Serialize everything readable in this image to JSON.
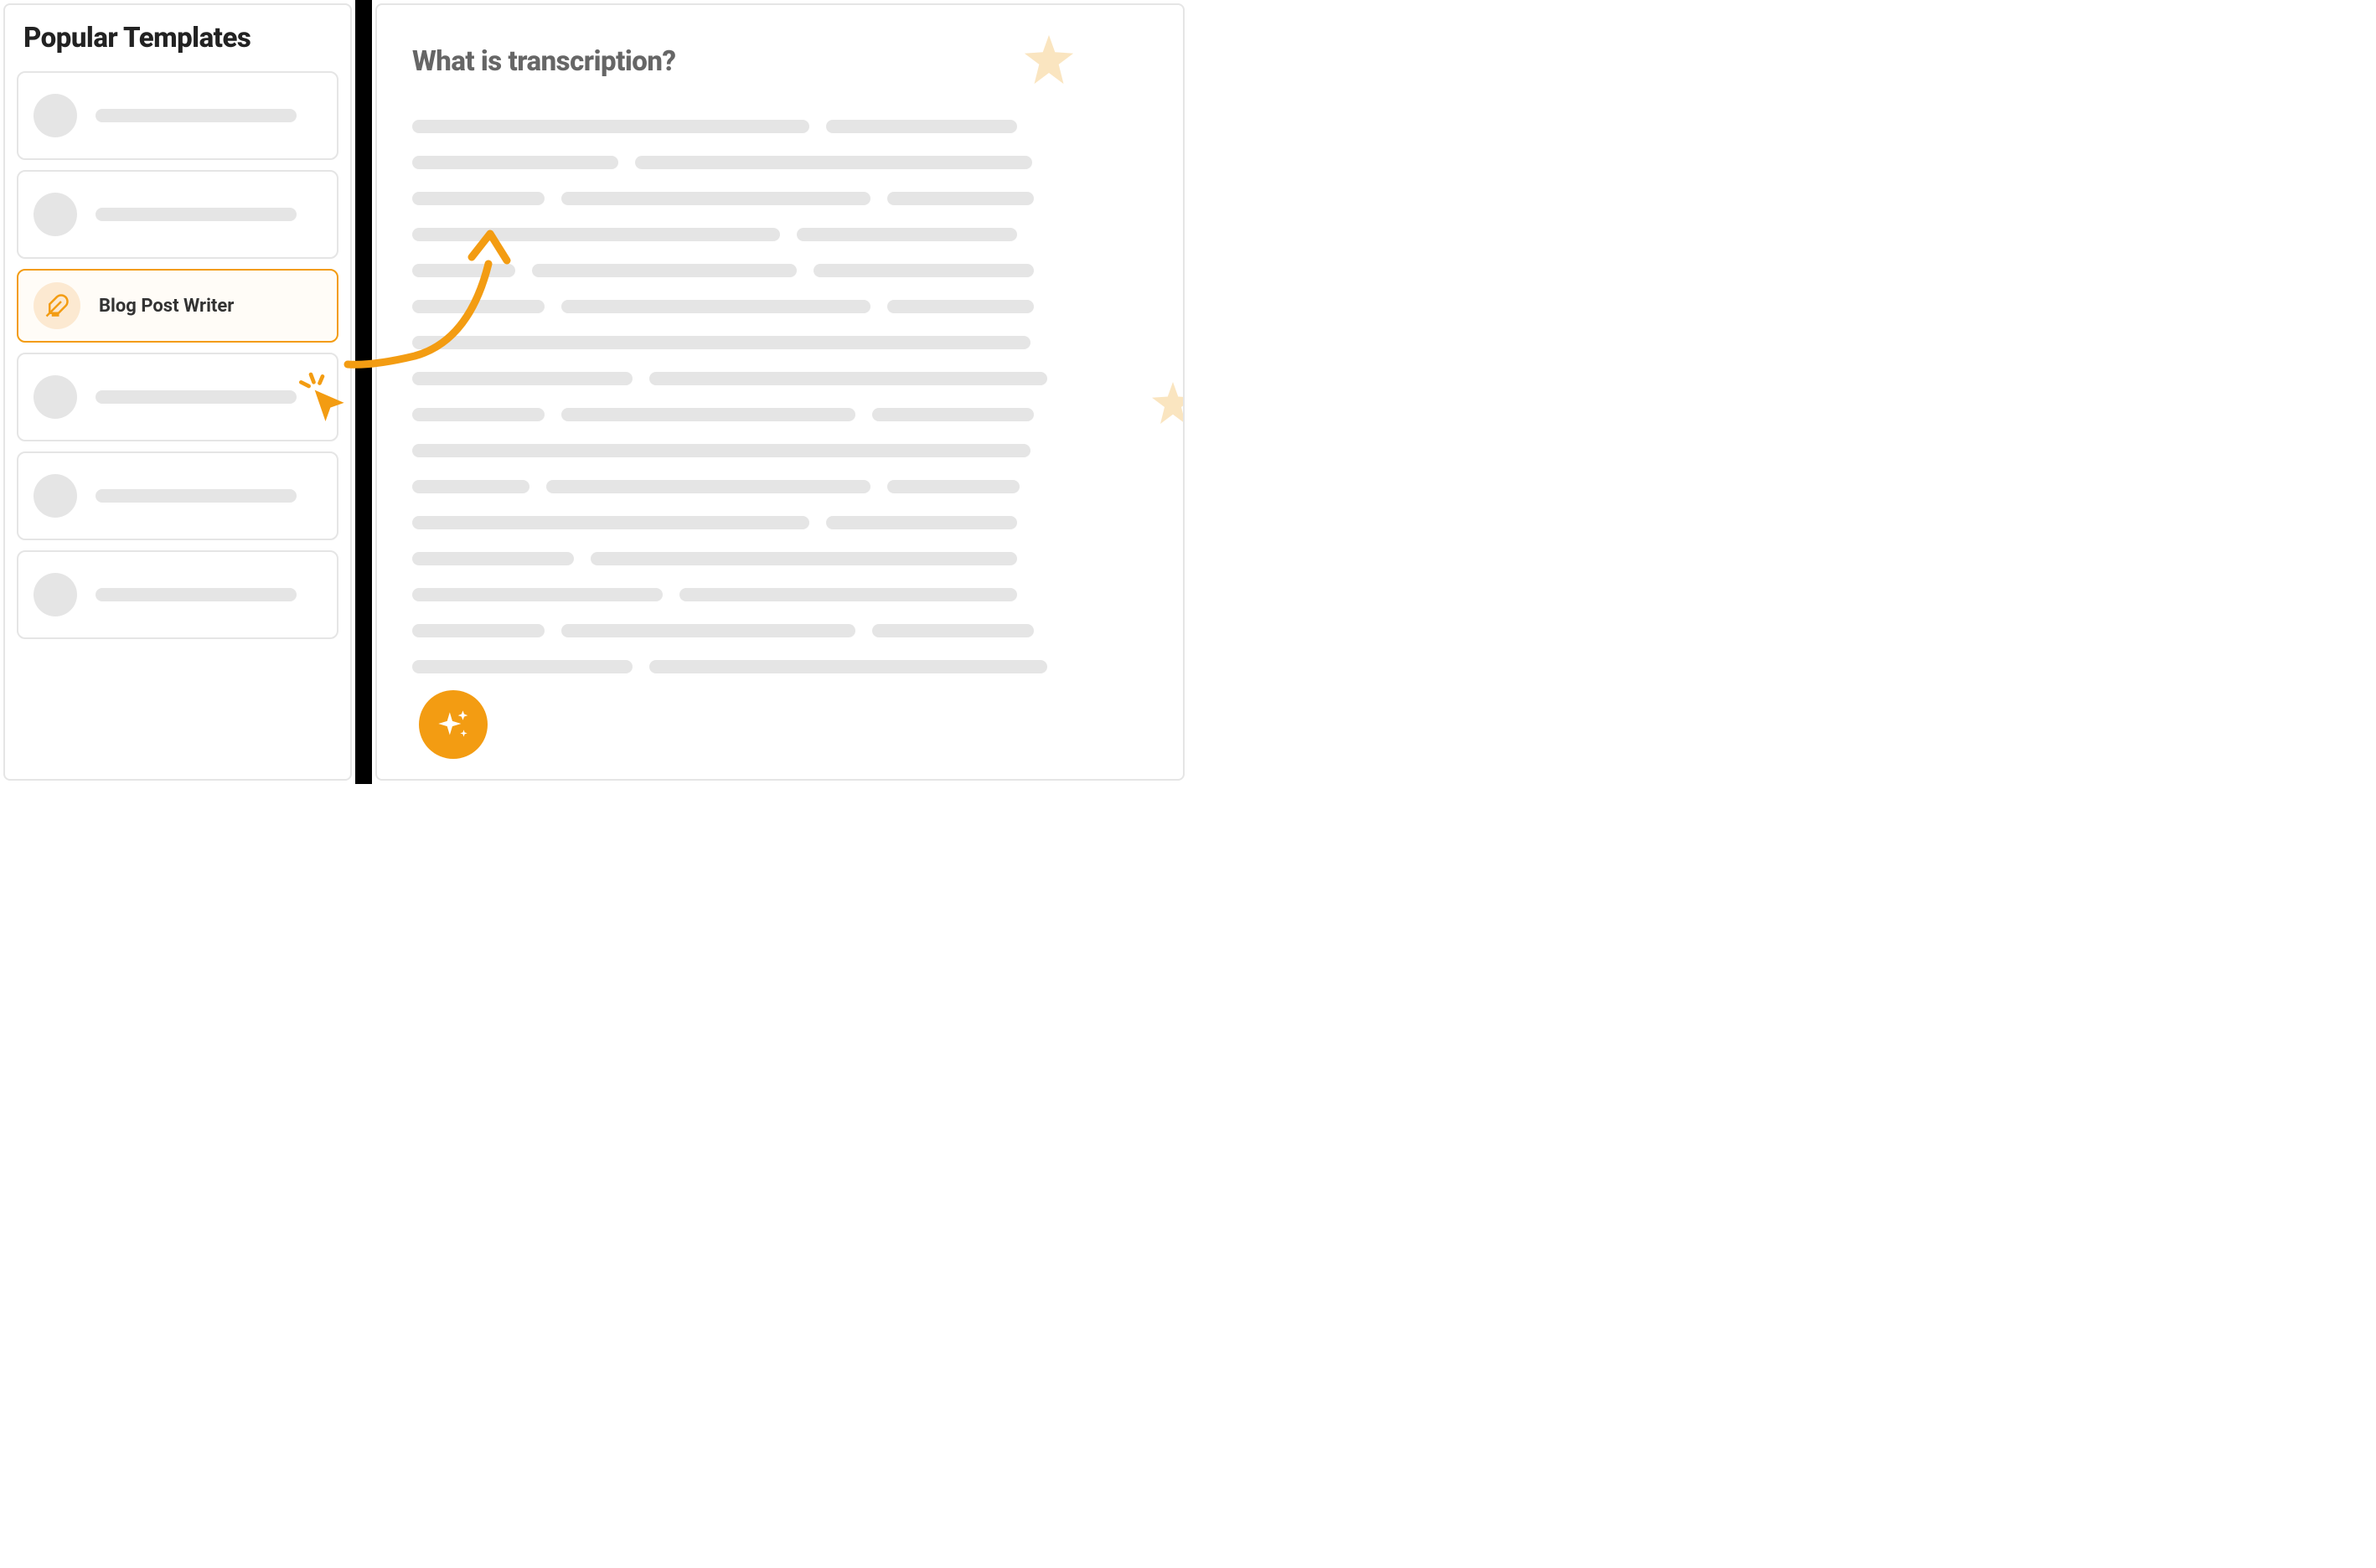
{
  "sidebar": {
    "title": "Popular Templates",
    "items": [
      {
        "placeholder": true
      },
      {
        "placeholder": true
      },
      {
        "icon": "feather-icon",
        "label": "Blog Post Writer",
        "selected": true
      },
      {
        "placeholder": true
      },
      {
        "placeholder": true
      },
      {
        "placeholder": true
      }
    ]
  },
  "content": {
    "title": "What is transcription?",
    "text_rows": [
      [
        {
          "w": 54
        },
        {
          "w": 26
        }
      ],
      [
        {
          "w": 28
        },
        {
          "w": 54
        }
      ],
      [
        {
          "w": 18
        },
        {
          "w": 42
        },
        {
          "w": 20
        }
      ],
      [
        {
          "w": 50
        },
        {
          "w": 30
        }
      ],
      [
        {
          "w": 14
        },
        {
          "w": 36
        },
        {
          "w": 30
        }
      ],
      [
        {
          "w": 18
        },
        {
          "w": 42
        },
        {
          "w": 20
        }
      ],
      [
        {
          "w": 84
        }
      ],
      [
        {
          "w": 30
        },
        {
          "w": 54
        }
      ],
      [
        {
          "w": 18
        },
        {
          "w": 40
        },
        {
          "w": 22
        }
      ],
      [
        {
          "w": 84
        }
      ],
      [
        {
          "w": 16
        },
        {
          "w": 44
        },
        {
          "w": 18
        }
      ],
      [
        {
          "w": 54
        },
        {
          "w": 26
        }
      ],
      [
        {
          "w": 22
        },
        {
          "w": 58
        }
      ],
      [
        {
          "w": 34
        },
        {
          "w": 46
        }
      ],
      [
        {
          "w": 18
        },
        {
          "w": 40
        },
        {
          "w": 22
        }
      ],
      [
        {
          "w": 30
        },
        {
          "w": 54
        }
      ]
    ]
  },
  "colors": {
    "accent": "#f39c12",
    "accent_light": "#fce9d1",
    "accent_pale": "#fae5c0",
    "placeholder": "#e5e5e5"
  }
}
